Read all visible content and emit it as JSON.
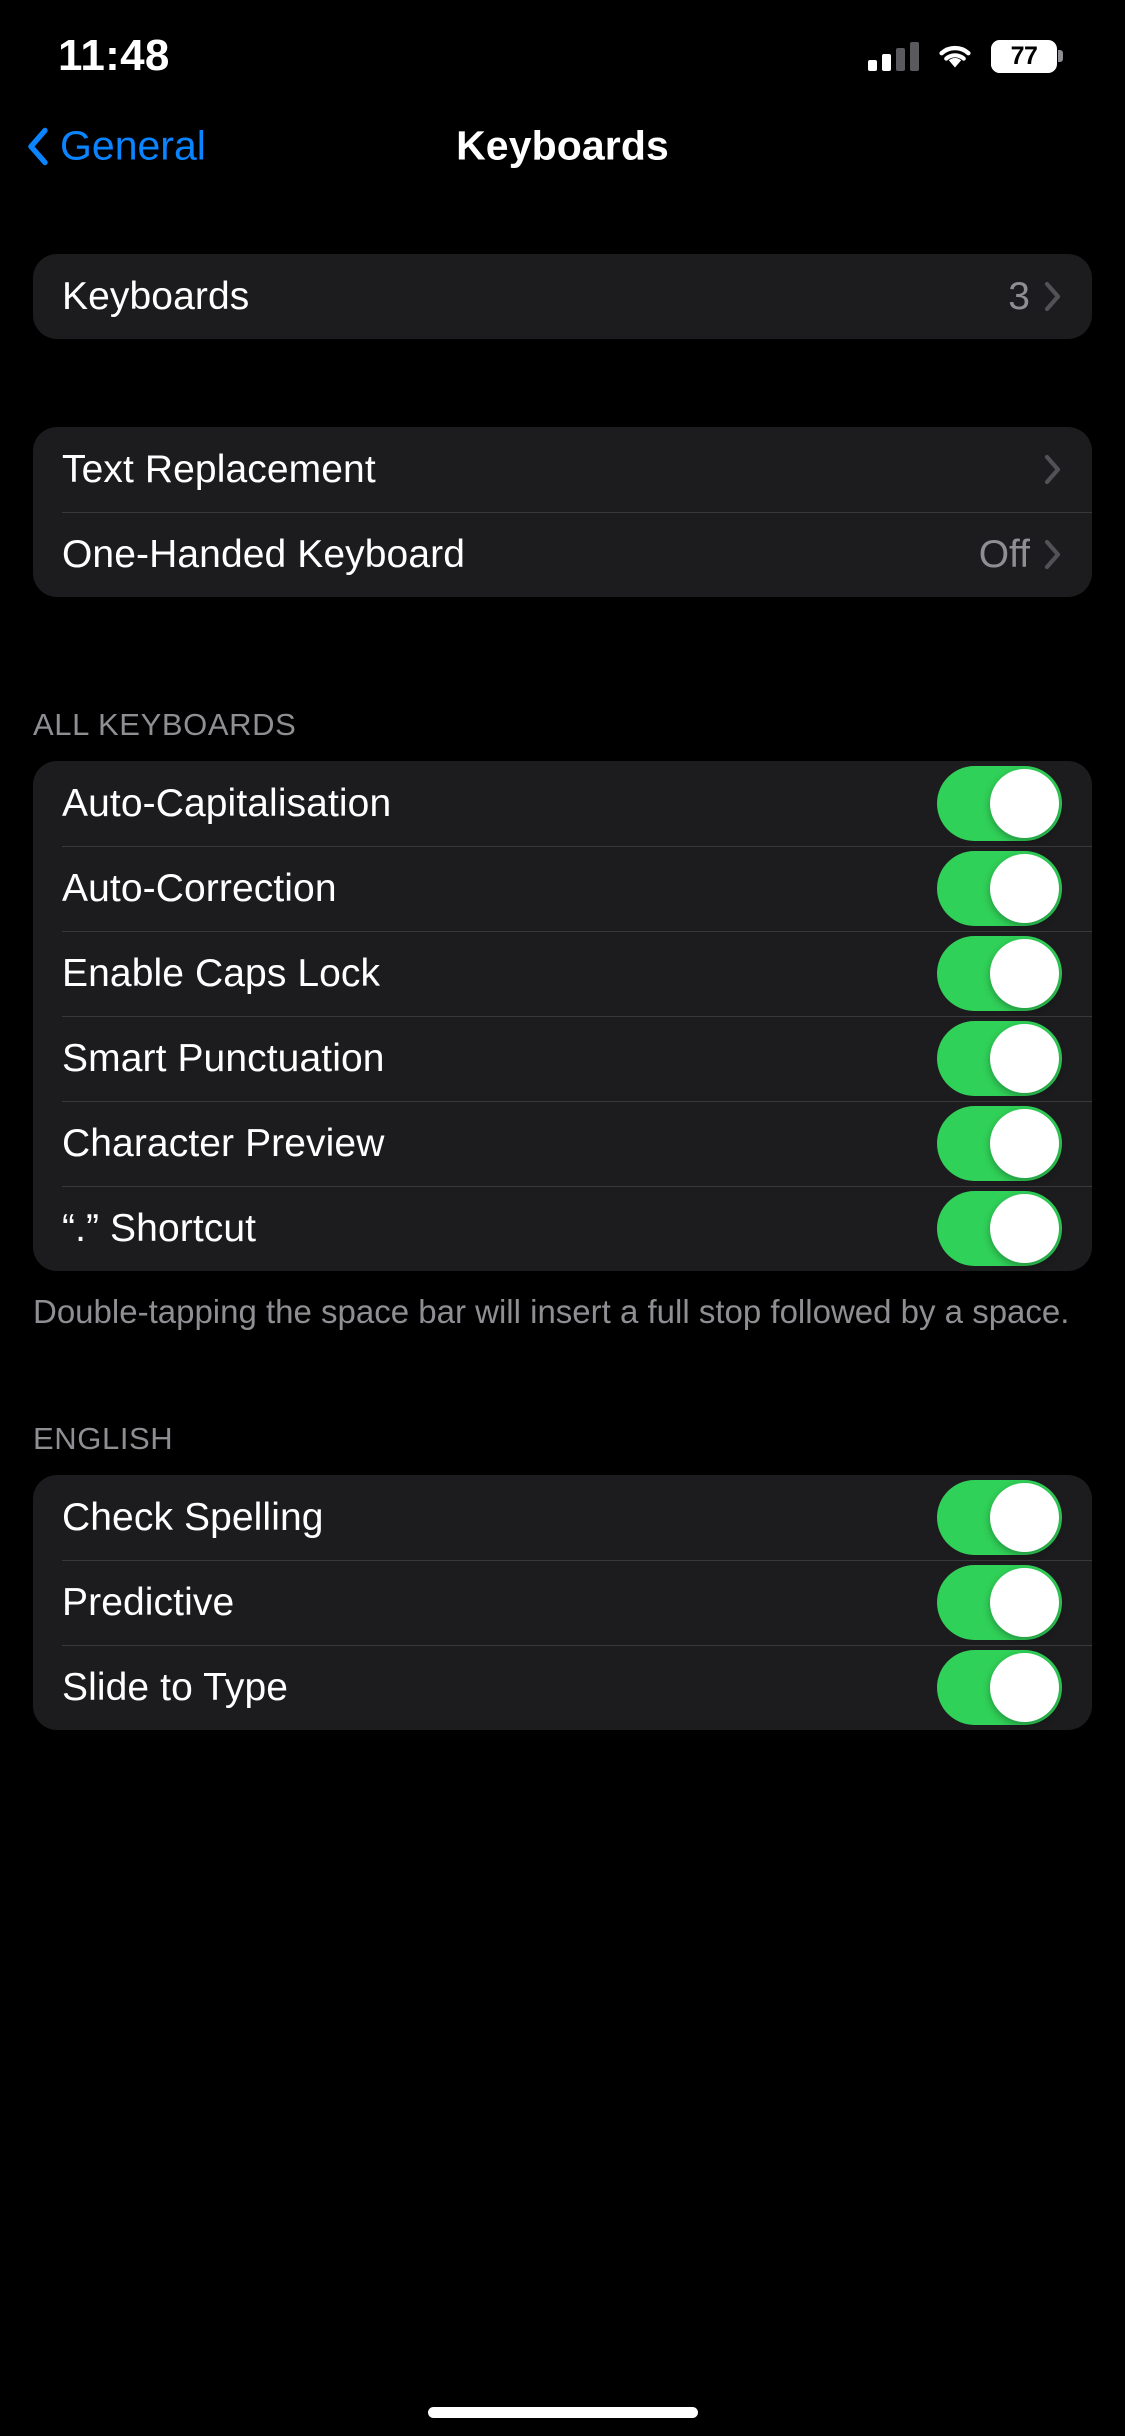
{
  "status_bar": {
    "time": "11:48",
    "battery_percent": "77",
    "signal_icon": "cellular-signal-icon",
    "wifi_icon": "wifi-icon",
    "battery_icon": "battery-icon"
  },
  "nav": {
    "back_label": "General",
    "back_icon": "chevron-left-icon",
    "title": "Keyboards"
  },
  "sections": {
    "keyboards_card": {
      "rows": [
        {
          "label": "Keyboards",
          "value": "3",
          "type": "disclosure"
        }
      ]
    },
    "text_card": {
      "rows": [
        {
          "label": "Text Replacement",
          "value": "",
          "type": "disclosure"
        },
        {
          "label": "One-Handed Keyboard",
          "value": "Off",
          "type": "disclosure"
        }
      ]
    },
    "all_keyboards": {
      "header": "ALL KEYBOARDS",
      "footer": "Double-tapping the space bar will insert a full stop followed by a space.",
      "rows": [
        {
          "label": "Auto-Capitalisation",
          "toggle": "on"
        },
        {
          "label": "Auto-Correction",
          "toggle": "on"
        },
        {
          "label": "Enable Caps Lock",
          "toggle": "on"
        },
        {
          "label": "Smart Punctuation",
          "toggle": "on"
        },
        {
          "label": "Character Preview",
          "toggle": "on"
        },
        {
          "label": "“.” Shortcut",
          "toggle": "on"
        }
      ]
    },
    "english": {
      "header": "ENGLISH",
      "rows": [
        {
          "label": "Check Spelling",
          "toggle": "on"
        },
        {
          "label": "Predictive",
          "toggle": "on"
        },
        {
          "label": "Slide to Type",
          "toggle": "on"
        }
      ]
    }
  },
  "colors": {
    "accent_blue": "#0A84FF",
    "toggle_green": "#30D158",
    "card_bg": "#1C1C1E",
    "secondary_text": "#8E8E93",
    "page_bg": "#000000"
  },
  "home_indicator": "home-indicator"
}
